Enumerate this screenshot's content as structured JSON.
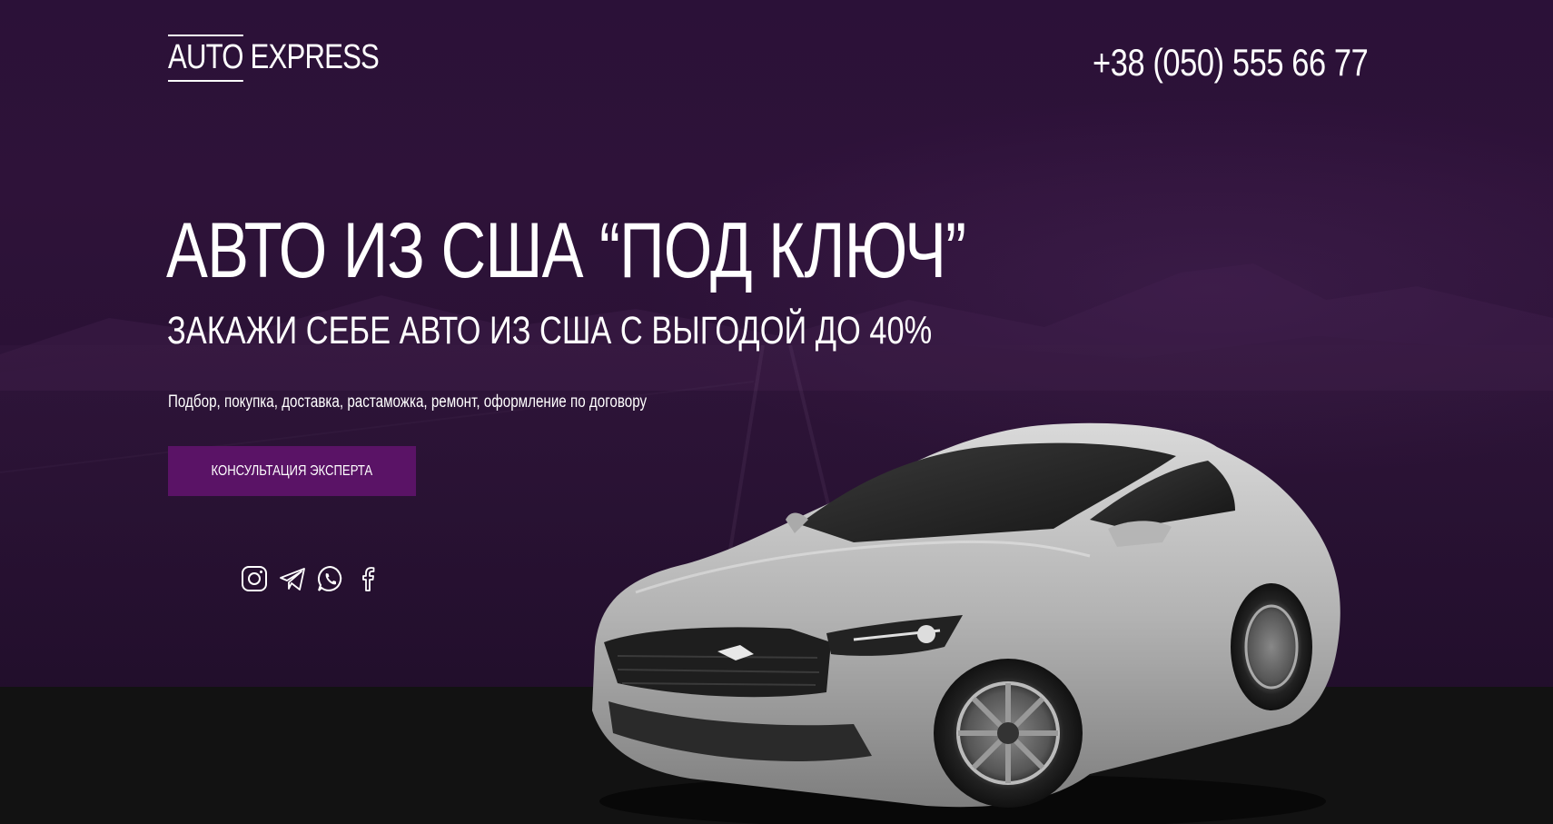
{
  "header": {
    "logo": {
      "part1": "AUTO",
      "part2": " EXPRESS"
    },
    "phone": "+38 (050) 555 66 77"
  },
  "hero": {
    "title": "АВТО ИЗ США “ПОД КЛЮЧ”",
    "subtitle": "ЗАКАЖИ СЕБЕ АВТО ИЗ США С ВЫГОДОЙ ДО 40%",
    "description": "Подбор, покупка, доставка, растаможка, ремонт, оформление по договору",
    "cta_label": "КОНСУЛЬТАЦИЯ ЭКСПЕРТА"
  },
  "socials": [
    {
      "icon": "instagram-icon"
    },
    {
      "icon": "telegram-icon"
    },
    {
      "icon": "whatsapp-icon"
    },
    {
      "icon": "facebook-icon"
    }
  ],
  "colors": {
    "hero_bg": "#2b1138",
    "cta_bg": "#5a1366",
    "bottom_band": "#121212",
    "text": "#ffffff"
  }
}
